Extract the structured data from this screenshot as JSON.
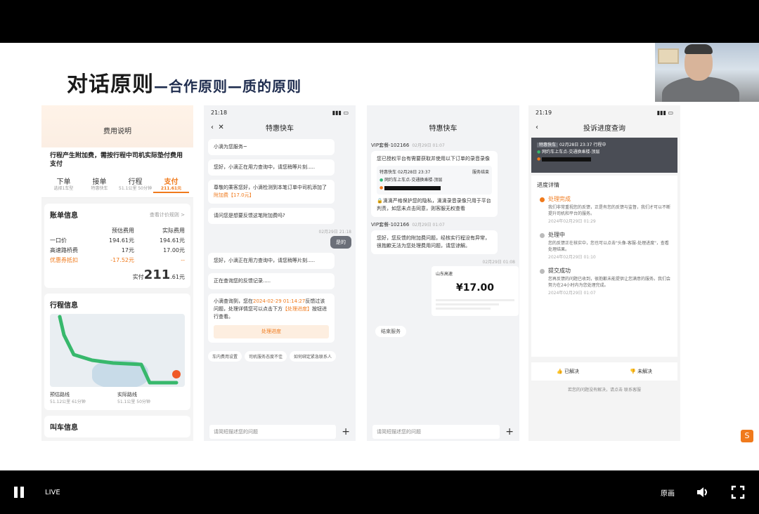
{
  "slide": {
    "title_main": "对话原则",
    "title_sub": "—合作原则—质的原则"
  },
  "phone1": {
    "header": "费用说明",
    "note": "行程产生附加费，需按行程中司机实际垫付费用支付",
    "steps": [
      {
        "t": "下单",
        "s": "选择1车型"
      },
      {
        "t": "接单",
        "s": "特惠快车"
      },
      {
        "t": "行程",
        "s": "51.1公里 50分钟"
      },
      {
        "t": "支付",
        "s": "211.61元"
      }
    ],
    "bill_title": "账单信息",
    "bill_link": "查看计价规则 >",
    "bill_head": [
      "预估费用",
      "实际费用"
    ],
    "bill_rows": [
      [
        "一口价",
        "194.61元",
        "194.61元"
      ],
      [
        "高速路桥费",
        "17元",
        "17.00元"
      ],
      [
        "优惠券抵扣",
        "-17.52元",
        "--"
      ]
    ],
    "paid_label": "实付",
    "paid_int": "211",
    "paid_dec": ".61元",
    "trip_title": "行程信息",
    "route_a_label": "预估路线",
    "route_a_sub": "51.12公里 61分钟",
    "route_b_label": "实际路线",
    "route_b_sub": "51.1公里 50分钟",
    "call_title": "叫车信息"
  },
  "phone2": {
    "time": "21:18",
    "title": "特惠快车",
    "m1": "小滴为您服务~",
    "m2": "您好，小滴正在用力查询中，请您稍等片刻.....",
    "m3a": "尊敬的乘客您好，小滴检测到本笔订单中司机添加了",
    "m3b": "附加费【17.0元】",
    "m4": "请问您是想要反馈这笔附加费吗?",
    "time2": "02月29日 21:18",
    "me": "是的",
    "m5": "您好，小滴正在用力查询中，请您稍等片刻.....",
    "m6": "正在查询您的反馈记录.....",
    "m7a": "小滴查询到，您在",
    "m7b": "2024-02-29 01:14:27",
    "m7c": "反馈过该问题，处理详情您可以点击下方",
    "m7d": "【处理进度】",
    "m7e": "按钮进行查看。",
    "btn": "处理进度",
    "quick": [
      "车内费用设置",
      "司机服务态度不佳",
      "如何绑定紧急联系人"
    ],
    "input": "请简短描述您的问题"
  },
  "phone3": {
    "title": "特惠快车",
    "vip1": "VIP套餐-102166",
    "vip1_time": "02月29日 01:07",
    "b1": "您已授权平台有需要获取并使用以下订单的录音录像",
    "order_tag": "特惠快车",
    "order_time": "02月28日 23:37",
    "order_status": "服务结束",
    "order_from": "网约车上车点-交通换乘楼-顶层",
    "lock_text": "滴滴严格保护您的隐私，滴滴录音录像只用于平台判责，如您未点击同意，则客服无权查看",
    "vip2": "VIP套餐-102166",
    "vip2_time": "02月29日 01:07",
    "b2": "您好，您反馈的附加费问题，经核实行程没有异常，很抱歉无法为您处理费用问题，请您谅解。",
    "time3": "02月29日 01:08",
    "receipt_top": "山东高速",
    "receipt_amt": "¥17.00",
    "end": "结束服务",
    "input": "请简短描述您的问题"
  },
  "phone4": {
    "time": "21:19",
    "title": "投诉进度查询",
    "sum_tag": "特惠快车",
    "sum_time": "02月28日 23:37",
    "sum_status": "行程中",
    "sum_from": "网约车上车点-交通换乘楼-顶层",
    "section": "进度详情",
    "items": [
      {
        "t": "处理完成",
        "d": "我们非常重视您的反馈，正是有您的反馈与监督，我们才可以不断提升司机和平台的服务。",
        "time": "2024年02月29日 01:29",
        "done": true
      },
      {
        "t": "处理中",
        "d": "您的反馈正在核实中，您也可以点击\"头像-客服-处理进度\"，查看处理结果。",
        "time": "2024年02月29日 01:10",
        "done": false
      },
      {
        "t": "提交成功",
        "d": "您再反馈的问题已收到，很抱歉未能提供让您满意的服务。我们会努力在24小时内为您处理完成。",
        "time": "2024年02月29日 01:07",
        "done": false
      }
    ],
    "solved": "已解决",
    "unsolved": "未解决",
    "footer": "若您的问题没有解决，请点击 联系客服"
  },
  "player": {
    "live": "LIVE",
    "quality": "原画"
  },
  "icons": {
    "pause": "pause-icon",
    "volume": "volume-icon",
    "fullscreen": "fullscreen-icon"
  },
  "colors": {
    "accent": "#f07a1c",
    "route": "#37b86c"
  }
}
